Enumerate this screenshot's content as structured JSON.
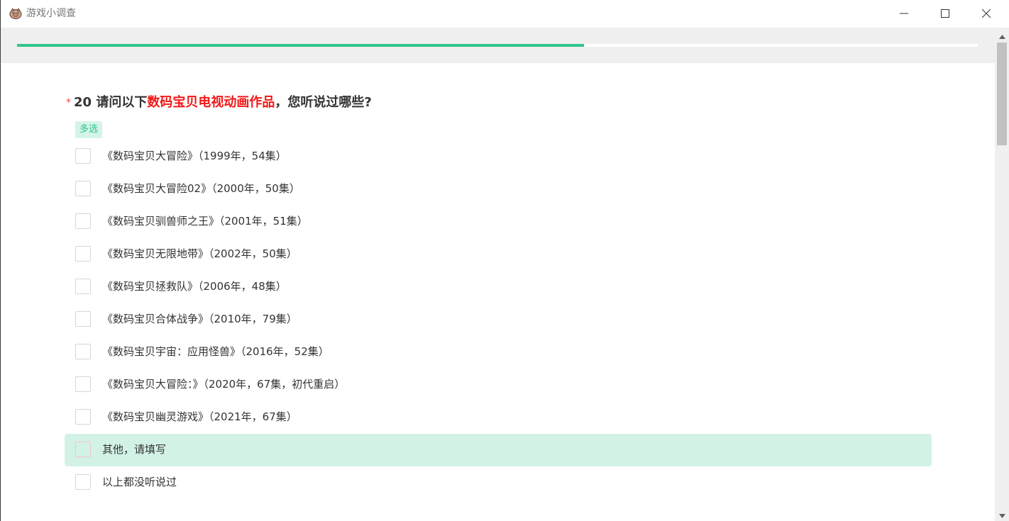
{
  "window": {
    "title": "游戏小调查",
    "app_icon": "pig-icon",
    "buttons": [
      "minimize-icon",
      "maximize-icon",
      "close-icon"
    ]
  },
  "progress": {
    "fraction": 0.59,
    "fill_color": "#2fc58a"
  },
  "question": {
    "required_mark": "*",
    "title_prefix": "20 请问以下",
    "title_highlight": "数码宝贝电视动画作品",
    "title_suffix": "，您听说过哪些?",
    "highlight_color": "#f21818",
    "type_tag": "多选",
    "options": [
      {
        "label": "《数码宝贝大冒险》（1999年，54集）",
        "checked": false
      },
      {
        "label": "《数码宝贝大冒险02》（2000年，50集）",
        "checked": false
      },
      {
        "label": "《数码宝贝驯兽师之王》（2001年，51集）",
        "checked": false
      },
      {
        "label": "《数码宝贝无限地带》（2002年，50集）",
        "checked": false
      },
      {
        "label": "《数码宝贝拯救队》（2006年，48集）",
        "checked": false
      },
      {
        "label": "《数码宝贝合体战争》（2010年，79集）",
        "checked": false
      },
      {
        "label": "《数码宝贝宇宙：应用怪兽》（2016年，52集）",
        "checked": false
      },
      {
        "label": "《数码宝贝大冒险：》（2020年，67集，初代重启）",
        "checked": false
      },
      {
        "label": "《数码宝贝幽灵游戏》（2021年，67集）",
        "checked": false
      },
      {
        "label": "其他，请填写",
        "checked": false,
        "hovered": true
      },
      {
        "label": "以上都没听说过",
        "checked": false
      }
    ]
  }
}
